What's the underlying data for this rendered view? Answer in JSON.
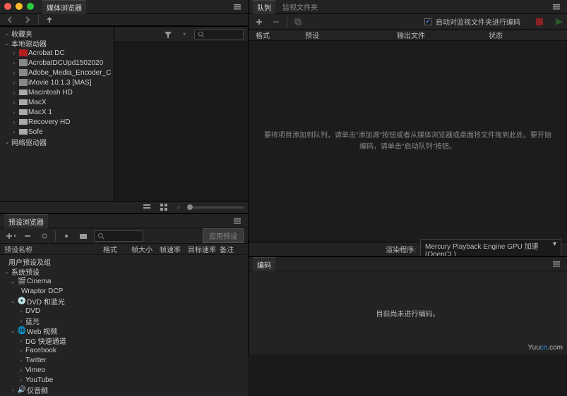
{
  "traffic": {
    "close": "close",
    "min": "min",
    "max": "max"
  },
  "media_browser": {
    "title": "媒体浏览器",
    "favorites": "收藏夹",
    "local_drives": "本地驱动器",
    "network_drives": "网络驱动器",
    "drives": [
      {
        "label": "Acrobat DC",
        "icon": "app-red"
      },
      {
        "label": "AcrobatDCUpd1502020",
        "icon": "pkg"
      },
      {
        "label": "Adobe_Media_Encoder_C",
        "icon": "pkg"
      },
      {
        "label": "iMovie 10.1.3 [MAS]",
        "icon": "pkg"
      },
      {
        "label": "Macintosh HD",
        "icon": "hd"
      },
      {
        "label": "MacX",
        "icon": "hd"
      },
      {
        "label": "MacX 1",
        "icon": "hd"
      },
      {
        "label": "Recovery HD",
        "icon": "hd"
      },
      {
        "label": "Sofe",
        "icon": "hd"
      }
    ]
  },
  "preset_browser": {
    "title": "预设浏览器",
    "apply": "应用预设",
    "cols": {
      "name": "预设名称",
      "format": "格式",
      "size": "帧大小",
      "fps": "帧速率",
      "target": "目标速率",
      "note": "备注"
    },
    "groups": {
      "user": "用户预设及组",
      "system": "系统预设",
      "cinema": "Cinema",
      "wraptor": "Wraptor DCP",
      "dvd": "DVD 和蓝光",
      "dvd_sub": "DVD",
      "bluray": "蓝光",
      "web": "Web 视频",
      "dg": "DG 快速通道",
      "fb": "Facebook",
      "tw": "Twitter",
      "vimeo": "Vimeo",
      "yt": "YouTube",
      "audio": "仅音频"
    }
  },
  "queue": {
    "tab_queue": "队列",
    "tab_watch": "监视文件夹",
    "auto_encode": "自动对监视文件夹进行编码",
    "cols": {
      "format": "格式",
      "preset": "预设",
      "output": "输出文件",
      "status": "状态"
    },
    "empty_msg": "要将项目添加到队列，请单击\"添加源\"按钮或者从媒体浏览器或桌面将文件拖到此处。要开始编码，请单击\"启动队列\"按钮。",
    "renderer_label": "渲染程序:",
    "renderer_value": "Mercury Playback Engine GPU 加速 (OpenCL)"
  },
  "encoding": {
    "title": "编码",
    "empty": "目前尚未进行编码。"
  },
  "watermark": {
    "a": "Yuu",
    "b": "cn",
    "c": ".com"
  }
}
